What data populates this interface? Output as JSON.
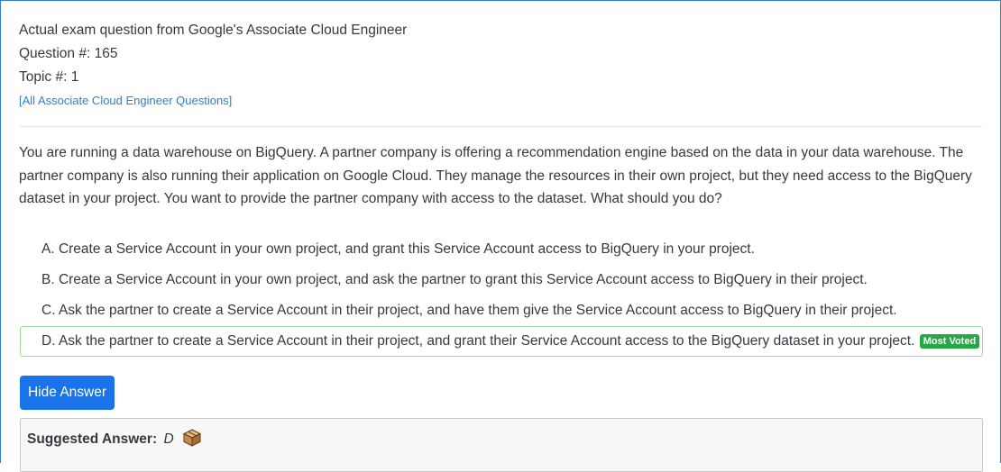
{
  "header": {
    "exam_line": "Actual exam question from Google's Associate Cloud Engineer",
    "question_number": "Question #: 165",
    "topic_number": "Topic #: 1",
    "all_questions_link": "[All Associate Cloud Engineer Questions]"
  },
  "question": {
    "text": "You are running a data warehouse on BigQuery. A partner company is offering a recommendation engine based on the data in your data warehouse. The partner company is also running their application on Google Cloud. They manage the resources in their own project, but they need access to the BigQuery dataset in your project. You want to provide the partner company with access to the dataset. What should you do?"
  },
  "choices": [
    {
      "text": "A. Create a Service Account in your own project, and grant this Service Account access to BigQuery in your project."
    },
    {
      "text": "B. Create a Service Account in your own project, and ask the partner to grant this Service Account access to BigQuery in their project."
    },
    {
      "text": "C. Ask the partner to create a Service Account in their project, and have them give the Service Account access to BigQuery in their project."
    },
    {
      "text": "D. Ask the partner to create a Service Account in their project, and grant their Service Account access to the BigQuery dataset in your project.",
      "badge": "Most Voted"
    }
  ],
  "actions": {
    "hide_answer_label": "Hide Answer"
  },
  "answer": {
    "label": "Suggested Answer:",
    "value": "D",
    "icon": "package-icon"
  },
  "colors": {
    "link": "#2f80c8",
    "button": "#1a73e8",
    "badge": "#28a745",
    "voted_border": "#9fd89f"
  }
}
